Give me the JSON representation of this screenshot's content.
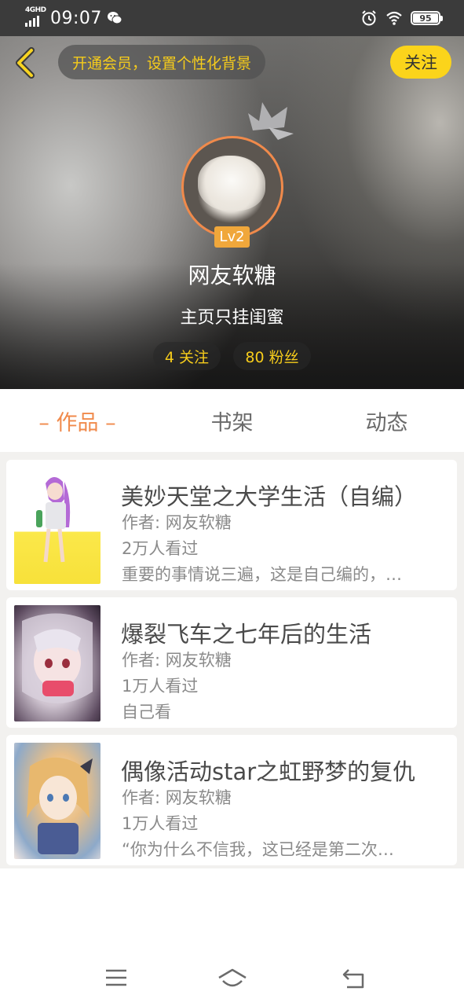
{
  "status_bar": {
    "network": "4GHD",
    "time": "09:07",
    "battery": "95",
    "icons": [
      "wechat-icon",
      "alarm-icon",
      "wifi-icon",
      "battery-icon"
    ]
  },
  "header": {
    "vip_prompt": "开通会员，设置个性化背景",
    "follow_label": "关注",
    "level": "Lv2",
    "username": "网友软糖",
    "bio": "主页只挂闺蜜",
    "following": "4 关注",
    "fans": "80 粉丝"
  },
  "tabs": [
    {
      "label": "– 作品 –",
      "active": true
    },
    {
      "label": "书架",
      "active": false
    },
    {
      "label": "动态",
      "active": false
    }
  ],
  "works": [
    {
      "title": "美妙天堂之大学生活（自编）",
      "author": "作者: 网友软糖",
      "views": "2万人看过",
      "desc": "重要的事情说三遍，这是自己编的，…"
    },
    {
      "title": "爆裂飞车之七年后的生活",
      "author": "作者: 网友软糖",
      "views": "1万人看过",
      "desc": "自己看"
    },
    {
      "title": "偶像活动star之虹野梦的复仇",
      "author": "作者: 网友软糖",
      "views": "1万人看过",
      "desc": "“你为什么不信我，这已经是第二次…"
    }
  ],
  "colors": {
    "accent_orange": "#f08a4b",
    "accent_yellow": "#fbd41b",
    "text_gray": "#8a8a8a"
  }
}
